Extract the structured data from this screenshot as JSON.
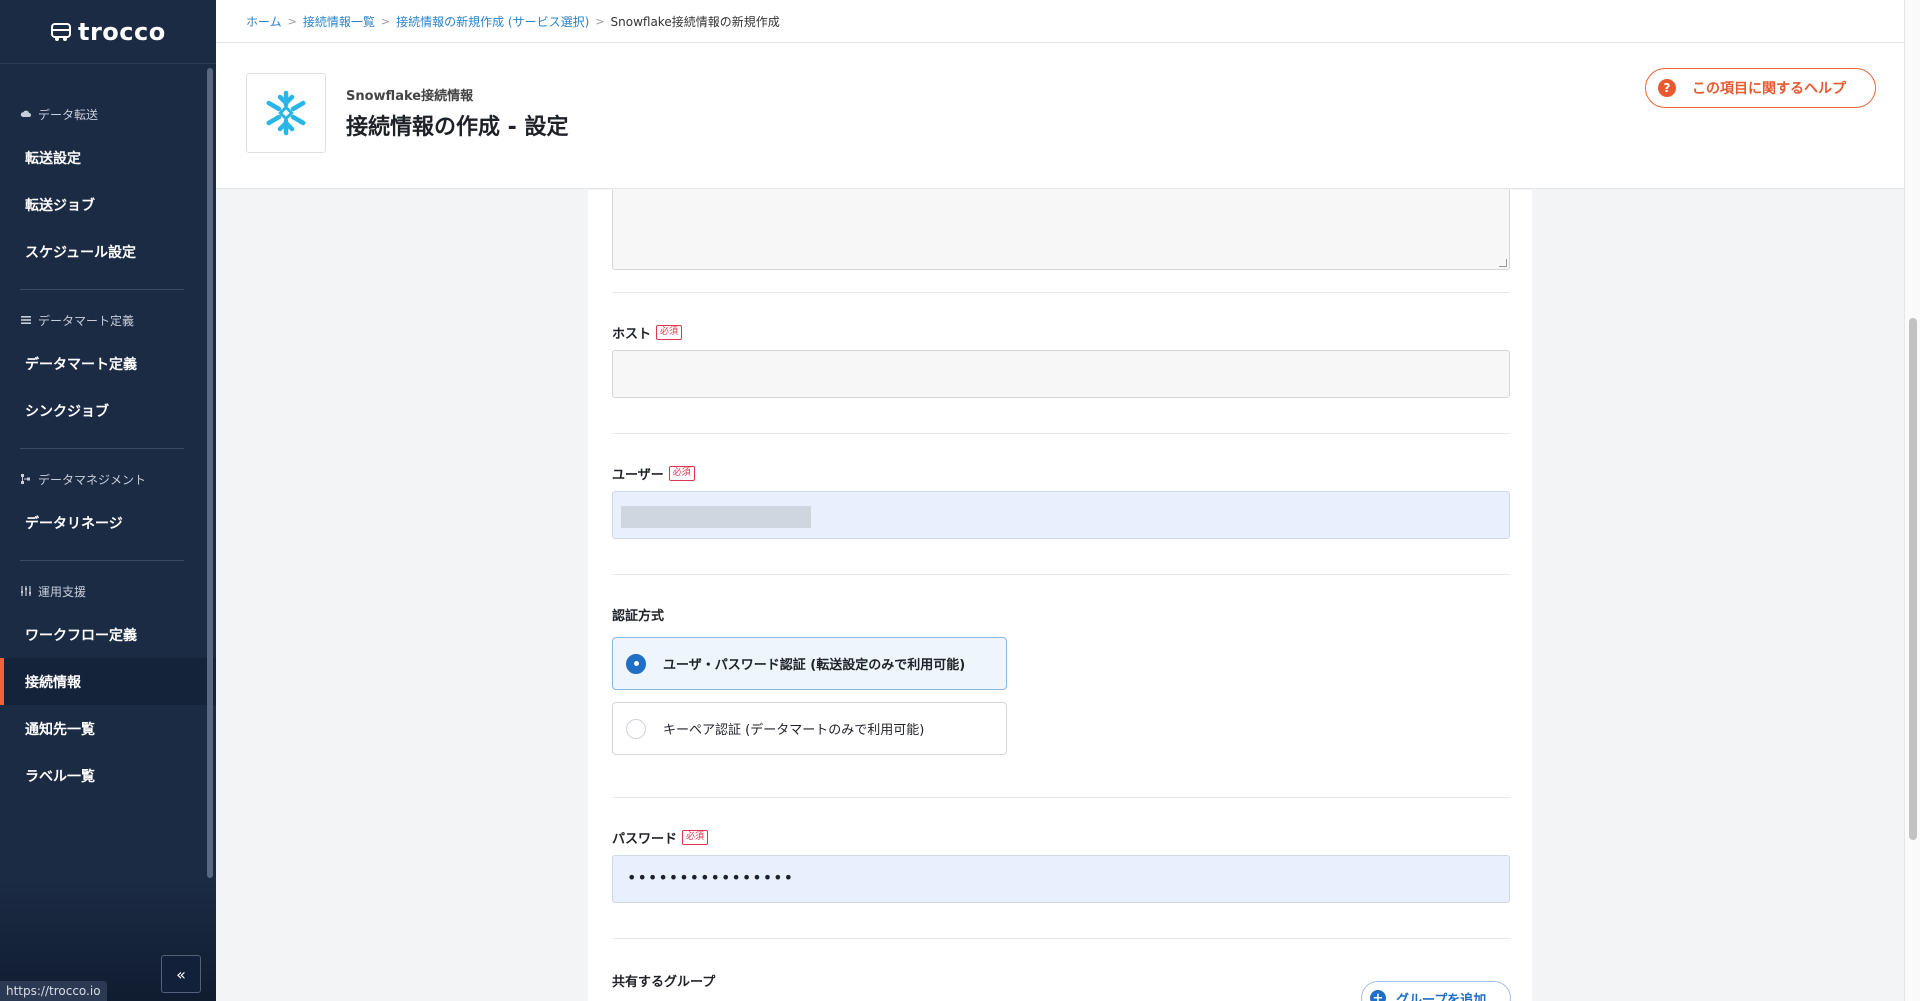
{
  "app": {
    "logo_text": "trocco",
    "status_url": "https://trocco.io",
    "collapse_label": "«"
  },
  "sidebar": {
    "sections": [
      {
        "head": "データ転送",
        "icon": "cloud-icon",
        "items": [
          "転送設定",
          "転送ジョブ",
          "スケジュール設定"
        ]
      },
      {
        "head": "データマート定義",
        "icon": "list-icon",
        "items": [
          "データマート定義",
          "シンクジョブ"
        ]
      },
      {
        "head": "データマネジメント",
        "icon": "lineage-icon",
        "items": [
          "データリネージ"
        ]
      },
      {
        "head": "運用支援",
        "icon": "sliders-icon",
        "items": [
          "ワークフロー定義",
          "接続情報",
          "通知先一覧",
          "ラベル一覧"
        ]
      }
    ],
    "active_item": "接続情報"
  },
  "breadcrumbs": [
    "ホーム",
    "接続情報一覧",
    "接続情報の新規作成 (サービス選択)",
    "Snowflake接続情報の新規作成"
  ],
  "header": {
    "subtitle": "Snowflake接続情報",
    "title": "接続情報の作成 - 設定",
    "help_label": "この項目に関するヘルプ",
    "brand_color": "#29b5e8"
  },
  "form": {
    "host_label": "ホスト",
    "user_label": "ユーザー",
    "required_badge": "必須",
    "auth_label": "認証方式",
    "auth_options": [
      {
        "label": "ユーザ・パスワード認証 (転送設定のみで利用可能)",
        "selected": true
      },
      {
        "label": "キーペア認証 (データマートのみで利用可能)",
        "selected": false
      }
    ],
    "password_label": "パスワード",
    "password_value": "••••••••••••••••",
    "groups_label": "共有するグループ",
    "add_group_label": "グループを追加"
  },
  "colors": {
    "sidebar_bg": "#1b2b44",
    "accent": "#f0623a",
    "link": "#2b83c9",
    "primary": "#1f6fc5"
  }
}
